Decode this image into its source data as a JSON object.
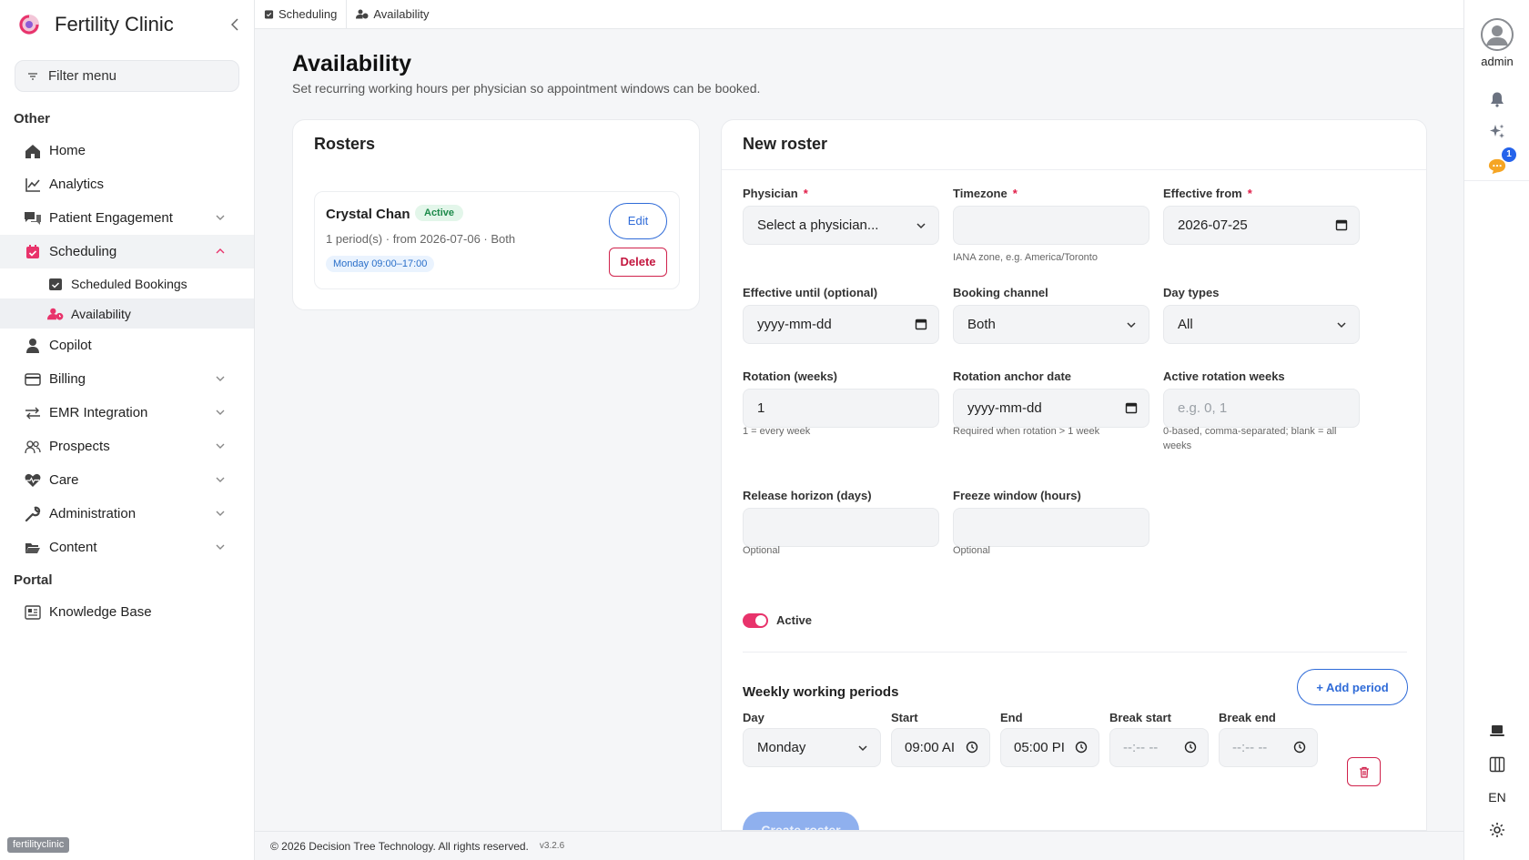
{
  "app": {
    "name": "Fertility Clinic",
    "tenant": "fertilityclinic"
  },
  "sidebar": {
    "filter_placeholder": "Filter menu",
    "sections": {
      "other": "Other",
      "portal": "Portal"
    },
    "items": {
      "home": "Home",
      "analytics": "Analytics",
      "patient_engagement": "Patient Engagement",
      "scheduling": "Scheduling",
      "scheduled_bookings": "Scheduled Bookings",
      "availability": "Availability",
      "copilot": "Copilot",
      "billing": "Billing",
      "emr_integration": "EMR Integration",
      "prospects": "Prospects",
      "care": "Care",
      "administration": "Administration",
      "content": "Content",
      "knowledge_base": "Knowledge Base"
    }
  },
  "breadcrumb": [
    "Scheduling",
    "Availability"
  ],
  "page": {
    "title": "Availability",
    "subtitle": "Set recurring working hours per physician so appointment windows can be booked."
  },
  "rosters": {
    "title": "Rosters",
    "entries": [
      {
        "name": "Crystal Chan",
        "status": "Active",
        "meta": "1 period(s) · from 2026-07-06 · Both",
        "period": "Monday 09:00–17:00",
        "edit_label": "Edit",
        "delete_label": "Delete"
      }
    ]
  },
  "form": {
    "title": "New roster",
    "physician": {
      "label": "Physician",
      "required": "*",
      "value": "Select a physician..."
    },
    "timezone": {
      "label": "Timezone",
      "required": "*",
      "value": "",
      "hint": "IANA zone, e.g. America/Toronto"
    },
    "effective_from": {
      "label": "Effective from",
      "required": "*",
      "value": "2026-07-25"
    },
    "effective_until": {
      "label": "Effective until (optional)",
      "value": "yyyy-mm-dd"
    },
    "booking_channel": {
      "label": "Booking channel",
      "value": "Both"
    },
    "day_types": {
      "label": "Day types",
      "value": "All"
    },
    "rotation_weeks": {
      "label": "Rotation (weeks)",
      "value": "1",
      "hint": "1 = every week"
    },
    "rotation_anchor": {
      "label": "Rotation anchor date",
      "value": "yyyy-mm-dd",
      "hint": "Required when rotation > 1 week"
    },
    "active_rotation_weeks": {
      "label": "Active rotation weeks",
      "placeholder": "e.g. 0, 1",
      "hint": "0-based, comma-separated; blank = all weeks"
    },
    "release_horizon": {
      "label": "Release horizon (days)",
      "value": "",
      "hint": "Optional"
    },
    "freeze_window": {
      "label": "Freeze window (hours)",
      "value": "",
      "hint": "Optional"
    },
    "active": {
      "label": "Active",
      "on": true
    },
    "periods": {
      "title": "Weekly working periods",
      "add_label": "+ Add period",
      "columns": {
        "day": "Day",
        "start": "Start",
        "end": "End",
        "break_start": "Break start",
        "break_end": "Break end"
      },
      "rows": [
        {
          "day": "Monday",
          "start": "09:00 AI",
          "end": "05:00 PI",
          "break_start": "--:-- --",
          "break_end": "--:-- --"
        }
      ]
    },
    "create_label": "Create roster"
  },
  "footer": {
    "copyright": "© 2026 Decision Tree Technology. All rights reserved.",
    "version": "v3.2.6"
  },
  "rail": {
    "user": "admin",
    "notification_count": "1",
    "language": "EN"
  },
  "colors": {
    "brand_pink": "#e8336b",
    "primary_blue": "#2f6bd8",
    "danger": "#d0224c",
    "active_green": "#1c8a4a"
  }
}
